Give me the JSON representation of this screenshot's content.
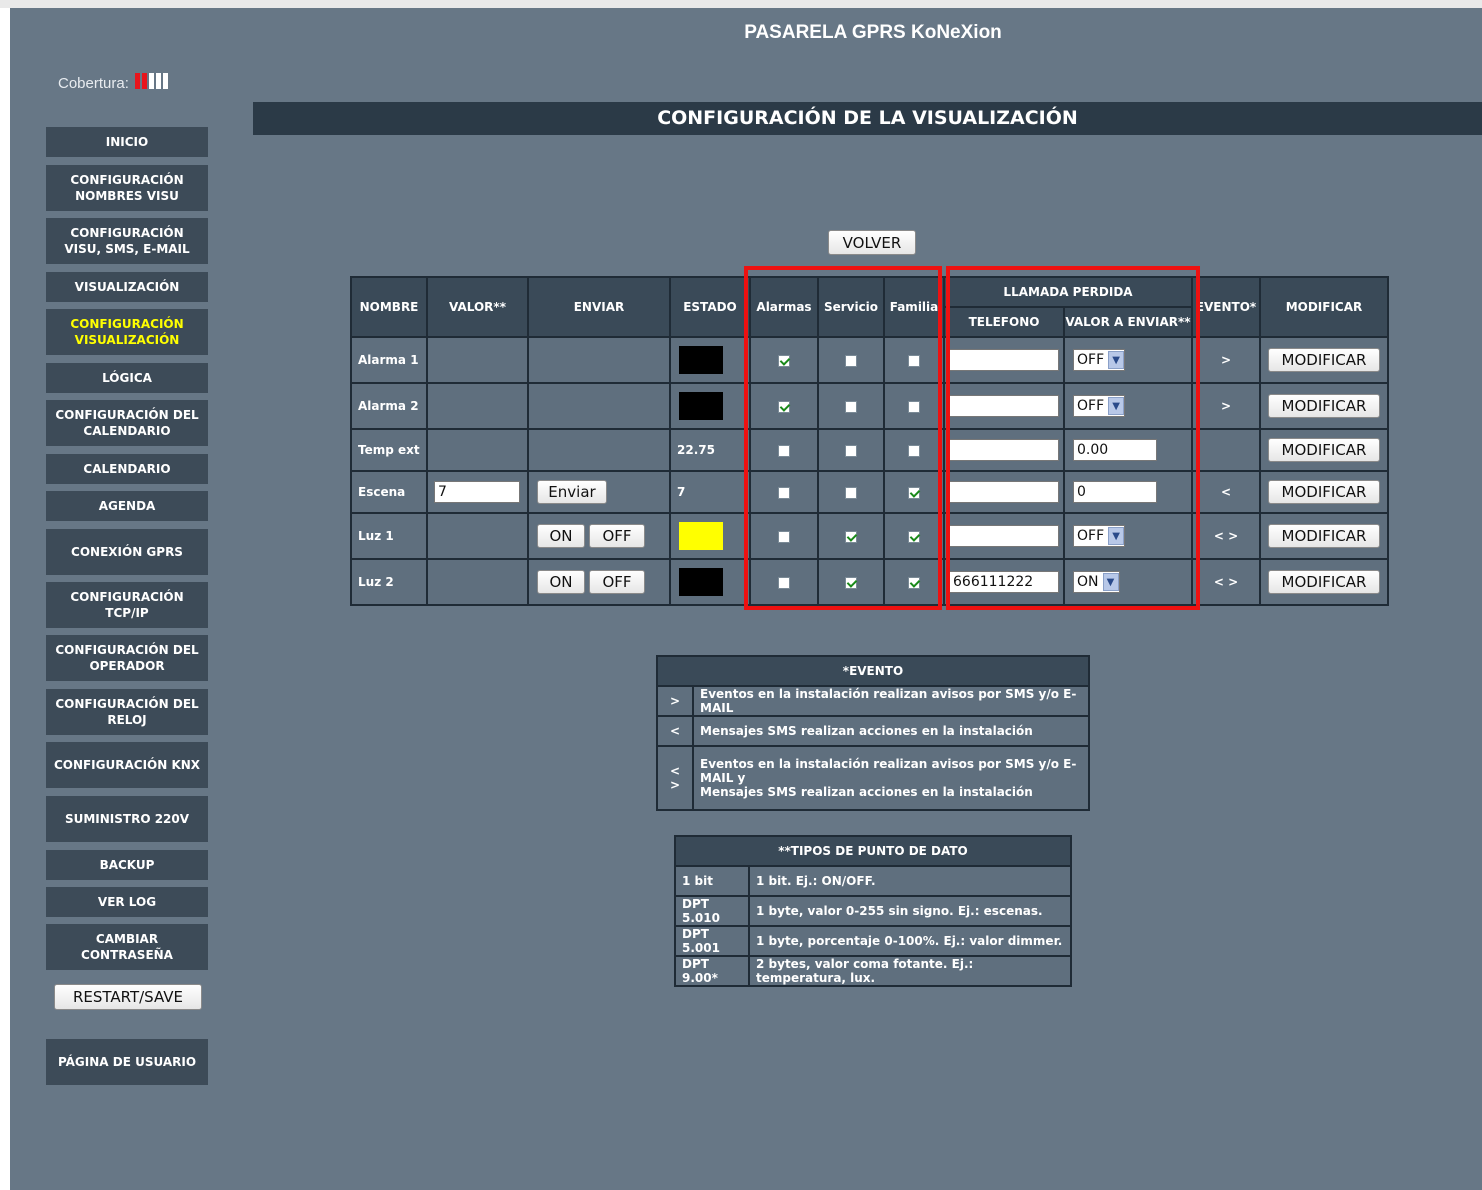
{
  "app_title": "PASARELA GPRS KoNeXion",
  "coverage": {
    "label": "Cobertura:",
    "bars_filled": 2,
    "bars_total": 5,
    "filled_color": "#e8141c",
    "empty_color": "#ffffff"
  },
  "page_title": "CONFIGURACIÓN DE LA VISUALIZACIÓN",
  "sidebar": {
    "items": [
      {
        "label": "INICIO",
        "active": false
      },
      {
        "label": "CONFIGURACIÓN NOMBRES VISU",
        "active": false
      },
      {
        "label": "CONFIGURACIÓN VISU, SMS, E-MAIL",
        "active": false
      },
      {
        "label": "VISUALIZACIÓN",
        "active": false
      },
      {
        "label": "CONFIGURACIÓN VISUALIZACIÓN",
        "active": true
      },
      {
        "label": "LÓGICA",
        "active": false
      },
      {
        "label": "CONFIGURACIÓN DEL CALENDARIO",
        "active": false
      },
      {
        "label": "CALENDARIO",
        "active": false
      },
      {
        "label": "AGENDA",
        "active": false
      },
      {
        "label": "CONEXIÓN GPRS",
        "active": false
      },
      {
        "label": "CONFIGURACIÓN TCP/IP",
        "active": false
      },
      {
        "label": "CONFIGURACIÓN DEL OPERADOR",
        "active": false
      },
      {
        "label": "CONFIGURACIÓN DEL RELOJ",
        "active": false
      },
      {
        "label": "CONFIGURACIÓN KNX",
        "active": false
      },
      {
        "label": "SUMINISTRO 220V",
        "active": false
      },
      {
        "label": "BACKUP",
        "active": false
      },
      {
        "label": "VER LOG",
        "active": false
      },
      {
        "label": "CAMBIAR CONTRASEÑA",
        "active": false
      }
    ],
    "restart_label": "RESTART/SAVE",
    "user_page_label": "PÁGINA DE USUARIO"
  },
  "volver_label": "VOLVER",
  "table": {
    "headers": {
      "nombre": "NOMBRE",
      "valor": "VALOR**",
      "enviar": "ENVIAR",
      "estado": "ESTADO",
      "alarmas": "Alarmas",
      "servicio": "Servicio",
      "familia": "Familia",
      "llamada": "LLAMADA PERDIDA",
      "telefono": "TELEFONO",
      "valor_enviar": "VALOR A ENVIAR**",
      "evento": "EVENTO*",
      "modificar": "MODIFICAR"
    },
    "rows": [
      {
        "name": "Alarma 1",
        "valor": "",
        "enviar": "",
        "estado_text": "",
        "estado_color": "#000000",
        "alarmas": true,
        "servicio": false,
        "familia": false,
        "telefono": "",
        "valor_enviar": "OFF",
        "valor_enviar_type": "select",
        "evento": ">",
        "modificar": "MODIFICAR"
      },
      {
        "name": "Alarma 2",
        "valor": "",
        "enviar": "",
        "estado_text": "",
        "estado_color": "#000000",
        "alarmas": true,
        "servicio": false,
        "familia": false,
        "telefono": "",
        "valor_enviar": "OFF",
        "valor_enviar_type": "select",
        "evento": ">",
        "modificar": "MODIFICAR"
      },
      {
        "name": "Temp ext",
        "valor": "",
        "enviar": "",
        "estado_text": "22.75",
        "estado_color": "",
        "alarmas": false,
        "servicio": false,
        "familia": false,
        "telefono": "",
        "valor_enviar": "0.00",
        "valor_enviar_type": "input",
        "evento": "",
        "modificar": "MODIFICAR"
      },
      {
        "name": "Escena",
        "valor": "7",
        "enviar": "Enviar",
        "estado_text": "7",
        "estado_color": "",
        "alarmas": false,
        "servicio": false,
        "familia": true,
        "telefono": "",
        "valor_enviar": "0",
        "valor_enviar_type": "input",
        "evento": "<",
        "modificar": "MODIFICAR"
      },
      {
        "name": "Luz 1",
        "valor": "",
        "enviar": "ON|OFF",
        "estado_text": "",
        "estado_color": "#ffff00",
        "alarmas": false,
        "servicio": true,
        "familia": true,
        "telefono": "",
        "valor_enviar": "OFF",
        "valor_enviar_type": "select",
        "evento": "< >",
        "modificar": "MODIFICAR"
      },
      {
        "name": "Luz 2",
        "valor": "",
        "enviar": "ON|OFF",
        "estado_text": "",
        "estado_color": "#000000",
        "alarmas": false,
        "servicio": true,
        "familia": true,
        "telefono": "666111222",
        "valor_enviar": "ON",
        "valor_enviar_type": "select",
        "evento": "< >",
        "modificar": "MODIFICAR"
      }
    ]
  },
  "evento_legend": {
    "title": "*EVENTO",
    "rows": [
      {
        "symbol": ">",
        "text": "Eventos en la instalación realizan avisos por SMS y/o E-MAIL"
      },
      {
        "symbol": "<",
        "text": "Mensajes SMS realizan acciones en la instalación"
      },
      {
        "symbol": "< >",
        "text": "Eventos en la instalación realizan avisos por SMS y/o E-MAIL y",
        "text2": "Mensajes SMS realizan acciones en la instalación"
      }
    ]
  },
  "tipos_legend": {
    "title": "**TIPOS DE PUNTO DE DATO",
    "rows": [
      {
        "type": "1 bit",
        "desc": "1 bit. Ej.: ON/OFF."
      },
      {
        "type": "DPT 5.010",
        "desc": "1 byte, valor 0-255 sin signo. Ej.: escenas."
      },
      {
        "type": "DPT 5.001",
        "desc": "1 byte, porcentaje 0-100%. Ej.: valor dimmer."
      },
      {
        "type": "DPT 9.00*",
        "desc": "2 bytes, valor coma fotante. Ej.: temperatura, lux."
      }
    ]
  },
  "colors": {
    "background": "#677786",
    "nav": "#3d4b58",
    "header_bar": "#2b3a47",
    "active_nav": "#ffff00",
    "highlight": "#ee1111"
  }
}
